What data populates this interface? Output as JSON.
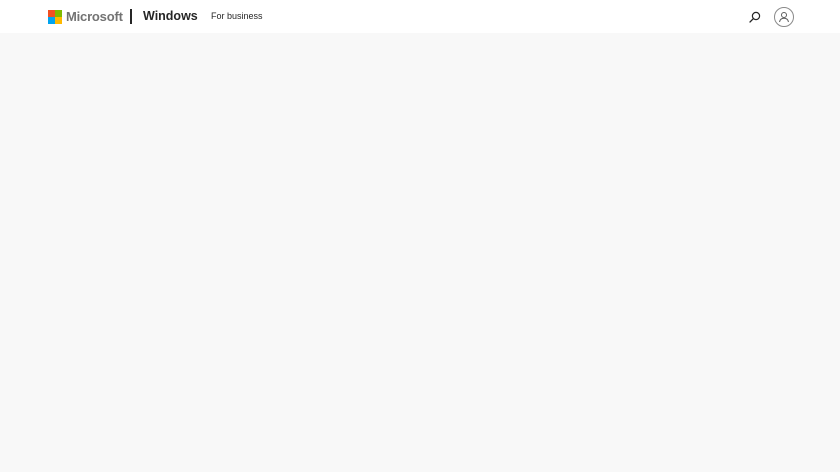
{
  "header": {
    "brand": "Microsoft",
    "product": "Windows",
    "nav_items": [
      {
        "label": "For business"
      }
    ],
    "search_icon": "search-icon",
    "account_icon": "account-icon"
  },
  "colors": {
    "logo_red": "#f25022",
    "logo_green": "#7fba00",
    "logo_blue": "#00a4ef",
    "logo_yellow": "#ffb900",
    "header_bg": "#ffffff",
    "page_bg": "#f8f8f8",
    "text_dark": "#262626",
    "brand_gray": "#737373"
  }
}
